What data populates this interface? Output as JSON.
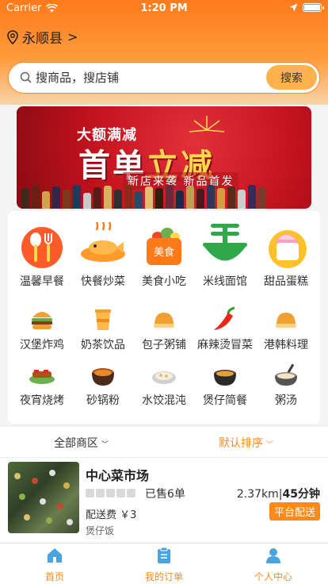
{
  "status_bar": {
    "carrier": "Carrier",
    "time": "1:20 PM"
  },
  "location": {
    "label": "永顺县"
  },
  "search": {
    "placeholder": "搜商品，搜店铺",
    "button": "搜索"
  },
  "banner": {
    "subtitle": "大额满减",
    "title_a": "首单",
    "title_b": "立减",
    "tagline": "新店来袭 新品首发"
  },
  "categories": [
    {
      "label": "温馨早餐",
      "icon": "breakfast-icon"
    },
    {
      "label": "快餐炒菜",
      "icon": "fish-dish-icon"
    },
    {
      "label": "美食小吃",
      "icon": "food-box-icon",
      "icon_text": "美食"
    },
    {
      "label": "米线面馆",
      "icon": "noodle-bowl-icon"
    },
    {
      "label": "甜品蛋糕",
      "icon": "ice-cream-icon"
    },
    {
      "label": "汉堡炸鸡",
      "icon": "burger-icon"
    },
    {
      "label": "奶茶饮品",
      "icon": "milk-tea-icon"
    },
    {
      "label": "包子粥铺",
      "icon": "bun-icon"
    },
    {
      "label": "麻辣烫冒菜",
      "icon": "chili-icon"
    },
    {
      "label": "港韩料理",
      "icon": "bread-icon"
    },
    {
      "label": "夜宵烧烤",
      "icon": "bbq-icon"
    },
    {
      "label": "砂锅粉",
      "icon": "claypot-icon"
    },
    {
      "label": "水饺混沌",
      "icon": "dumpling-icon"
    },
    {
      "label": "煲仔简餐",
      "icon": "rice-pot-icon"
    },
    {
      "label": "粥汤",
      "icon": "soup-icon"
    }
  ],
  "filters": {
    "area": "全部商区",
    "sort": "默认排序"
  },
  "store": {
    "name": "中心菜市场",
    "sold": "已售6单",
    "distance": "2.37km",
    "time": "45分钟",
    "fee": "配送费 ￥3",
    "delivery_badge": "平台配送",
    "tag": "煲仔饭",
    "rating_stars": 0
  },
  "tabs": [
    {
      "label": "首页",
      "icon": "home-icon"
    },
    {
      "label": "我的订单",
      "icon": "clipboard-icon"
    },
    {
      "label": "个人中心",
      "icon": "person-icon"
    }
  ],
  "colors": {
    "accent": "#ff8a1a",
    "header": "#ff7a1a",
    "banner": "#c2121d"
  }
}
